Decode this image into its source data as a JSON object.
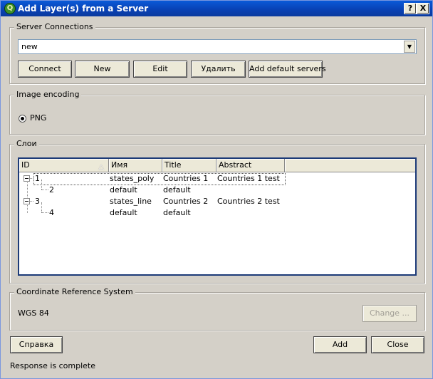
{
  "window": {
    "title": "Add Layer(s) from a Server",
    "app_icon_glyph": "Q",
    "help_glyph": "?",
    "close_glyph": "X"
  },
  "server_connections": {
    "legend": "Server Connections",
    "selected": "new",
    "buttons": {
      "connect": "Connect",
      "new": "New",
      "edit": "Edit",
      "delete": "Удалить",
      "add_default": "Add default servers"
    }
  },
  "image_encoding": {
    "legend": "Image encoding",
    "options": [
      {
        "label": "PNG",
        "selected": true
      }
    ]
  },
  "layers": {
    "legend": "Слои",
    "columns": [
      "ID",
      "Имя",
      "Title",
      "Abstract"
    ],
    "sort_indicator": "△",
    "rows": [
      {
        "id": "1",
        "name": "states_poly",
        "title": "Countries 1",
        "abstract": "Countries 1 test",
        "level": 0
      },
      {
        "id": "2",
        "name": "default",
        "title": "default",
        "abstract": "",
        "level": 1
      },
      {
        "id": "3",
        "name": "states_line",
        "title": "Countries 2",
        "abstract": "Countries 2 test",
        "level": 0
      },
      {
        "id": "4",
        "name": "default",
        "title": "default",
        "abstract": "",
        "level": 1
      }
    ]
  },
  "crs": {
    "legend": "Coordinate Reference System",
    "value": "WGS 84",
    "change_label": "Change ..."
  },
  "footer": {
    "help_label": "Справка",
    "add_label": "Add",
    "close_label": "Close",
    "status": "Response is complete"
  },
  "icons": {
    "combo_arrow": "▼",
    "app": "qgis-logo-icon"
  }
}
